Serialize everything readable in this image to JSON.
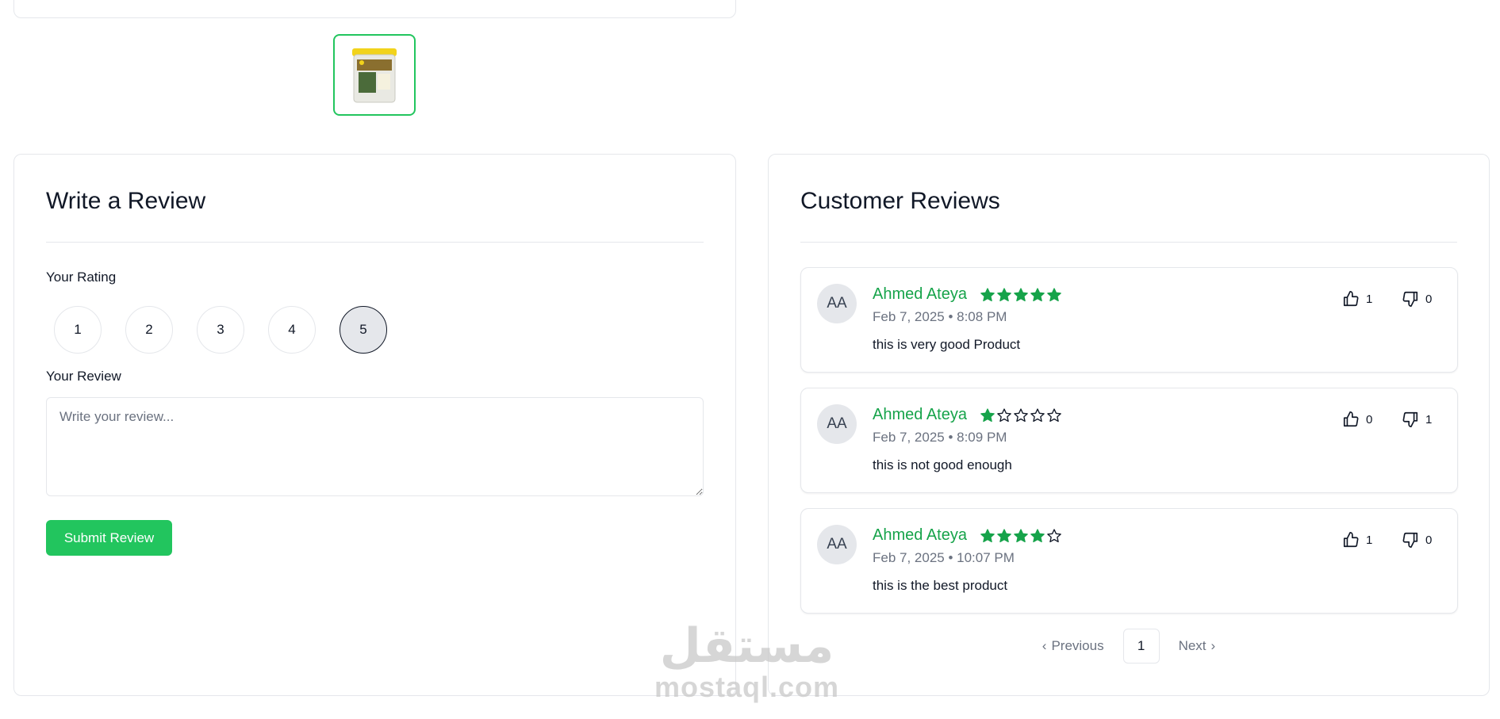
{
  "product": {
    "thumbnail_icon": "product-package-image"
  },
  "write_review": {
    "title": "Write a Review",
    "rating_label": "Your Rating",
    "rating_options": [
      "1",
      "2",
      "3",
      "4",
      "5"
    ],
    "selected_rating": "5",
    "review_label": "Your Review",
    "review_placeholder": "Write your review...",
    "review_value": "",
    "submit_label": "Submit Review"
  },
  "customer_reviews": {
    "title": "Customer Reviews",
    "reviews": [
      {
        "initials": "AA",
        "name": "Ahmed Ateya",
        "rating": 5,
        "date": "Feb 7, 2025 • 8:08 PM",
        "text": "this is very good Product",
        "likes": "1",
        "dislikes": "0"
      },
      {
        "initials": "AA",
        "name": "Ahmed Ateya",
        "rating": 1,
        "date": "Feb 7, 2025 • 8:09 PM",
        "text": "this is not good enough",
        "likes": "0",
        "dislikes": "1"
      },
      {
        "initials": "AA",
        "name": "Ahmed Ateya",
        "rating": 4,
        "date": "Feb 7, 2025 • 10:07 PM",
        "text": "this is the best product",
        "likes": "1",
        "dislikes": "0"
      }
    ],
    "pagination": {
      "previous_label": "Previous",
      "current_page": "1",
      "next_label": "Next"
    }
  },
  "watermark": {
    "arabic": "مستقل",
    "latin": "mostaql.com"
  },
  "colors": {
    "accent": "#22c55e",
    "name_green": "#16a34a",
    "star_fill": "#16a34a",
    "border": "#e5e7eb",
    "muted_text": "#6b7280"
  }
}
